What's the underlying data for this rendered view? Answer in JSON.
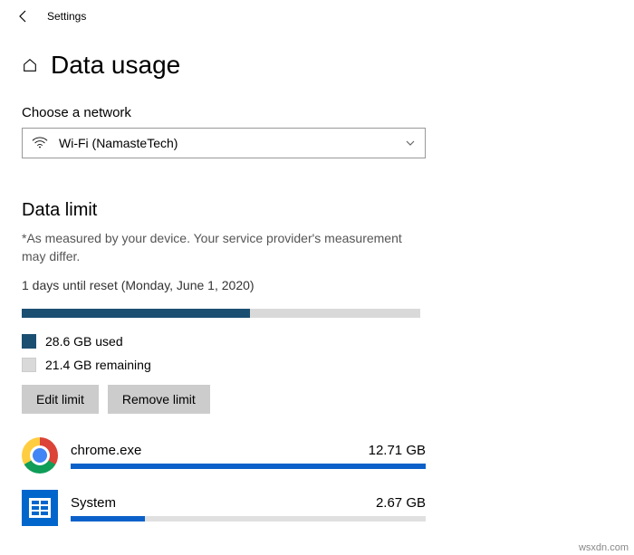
{
  "titlebar": {
    "label": "Settings"
  },
  "header": {
    "title": "Data usage"
  },
  "network": {
    "label": "Choose a network",
    "selected": "Wi-Fi (NamasteTech)"
  },
  "dataLimit": {
    "title": "Data limit",
    "note": "*As measured by your device. Your service provider's measurement may differ.",
    "resetInfo": "1 days until reset (Monday, June 1, 2020)",
    "usedLabel": "28.6 GB used",
    "remainingLabel": "21.4 GB remaining",
    "usedGB": 28.6,
    "totalGB": 50.0,
    "buttons": {
      "edit": "Edit limit",
      "remove": "Remove limit"
    }
  },
  "apps": [
    {
      "name": "chrome.exe",
      "usage": "12.71 GB",
      "usageGB": 12.71
    },
    {
      "name": "System",
      "usage": "2.67 GB",
      "usageGB": 2.67
    }
  ],
  "attribution": "wsxdn.com"
}
